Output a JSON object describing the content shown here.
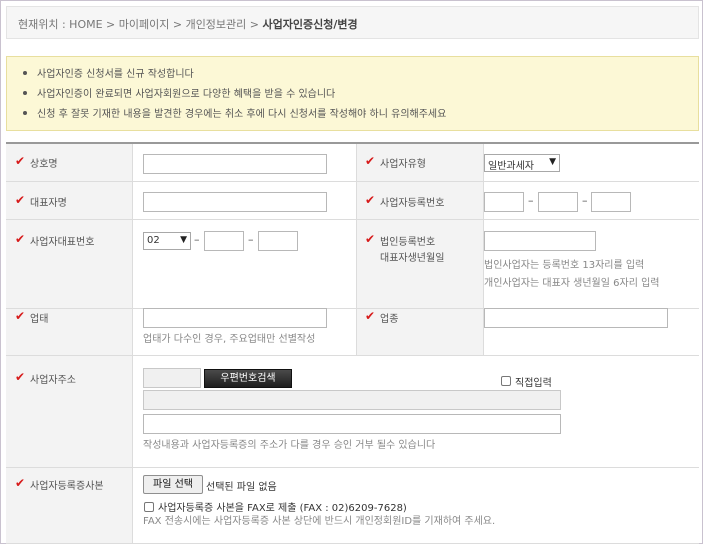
{
  "breadcrumb": {
    "prefix": "현재위치 : HOME > 마이페이지 > 개인정보관리 > ",
    "current": "사업자인증신청/변경"
  },
  "notice": {
    "items": [
      "사업자인증 신청서를 신규 작성합니다",
      "사업자인증이 완료되면 사업자회원으로 다양한 혜택을 받을 수 있습니다",
      "신청 후 잘못 기재한 내용을 발견한 경우에는 취소 후에 다시 신청서를 작성해야 하니 유의해주세요"
    ]
  },
  "form": {
    "check_mark": "✔",
    "company_name": {
      "label": "상호명",
      "value": ""
    },
    "business_type": {
      "label": "사업자유형",
      "selected": "일반과세자"
    },
    "ceo_name": {
      "label": "대표자명",
      "value": ""
    },
    "biz_reg_no": {
      "label": "사업자등록번호",
      "separator": "–"
    },
    "rep_phone": {
      "label": "사업자대표번호",
      "area_code": "02",
      "separator": "–"
    },
    "corp_no": {
      "label_line1": "법인등록번호",
      "label_line2": "대표자생년월일",
      "help_line1": "법인사업자는 등록번호 13자리를 입력",
      "help_line2": "개인사업자는 대표자 생년월일 6자리 입력"
    },
    "business_category": {
      "label": "업태",
      "help": "업태가 다수인 경우, 주요업태만 선별작성"
    },
    "business_item": {
      "label": "업종"
    },
    "address": {
      "label": "사업자주소",
      "zip_button": "우편번호검색",
      "direct_input_label": "직접입력",
      "help": "작성내용과 사업자등록증의 주소가 다를 경우 승인 거부 될수 있습니다"
    },
    "reg_copy": {
      "label": "사업자등록증사본",
      "file_button": "파일 선택",
      "file_status": "선택된 파일 없음",
      "fax_label": "사업자등록증 사본을 FAX로 제출 (FAX : 02)6209-7628)",
      "fax_help": "FAX 전송시에는 사업자등록증 사본 상단에 반드시 개인정회원ID를 기재하여 주세요."
    }
  }
}
